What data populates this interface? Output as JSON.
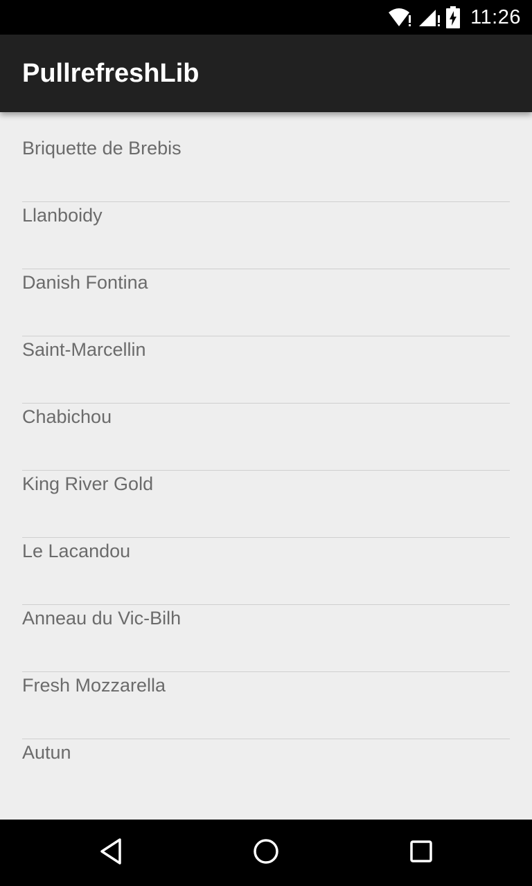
{
  "status_bar": {
    "time": "11:26",
    "icons": [
      "wifi-icon",
      "signal-icon",
      "battery-charging-icon"
    ]
  },
  "app_bar": {
    "title": "PullrefreshLib"
  },
  "list": {
    "items": [
      {
        "label": "Briquette de Brebis"
      },
      {
        "label": "Llanboidy"
      },
      {
        "label": "Danish Fontina"
      },
      {
        "label": "Saint-Marcellin"
      },
      {
        "label": "Chabichou"
      },
      {
        "label": "King River Gold"
      },
      {
        "label": "Le Lacandou"
      },
      {
        "label": "Anneau du Vic-Bilh"
      },
      {
        "label": "Fresh Mozzarella"
      },
      {
        "label": "Autun"
      }
    ]
  },
  "nav_bar": {
    "icons": [
      "back-icon",
      "home-icon",
      "recents-icon"
    ]
  },
  "colors": {
    "app_bar": "#212121",
    "background": "#eeeeee",
    "list_text": "#6b6b6b",
    "divider": "#cfcfcf"
  }
}
